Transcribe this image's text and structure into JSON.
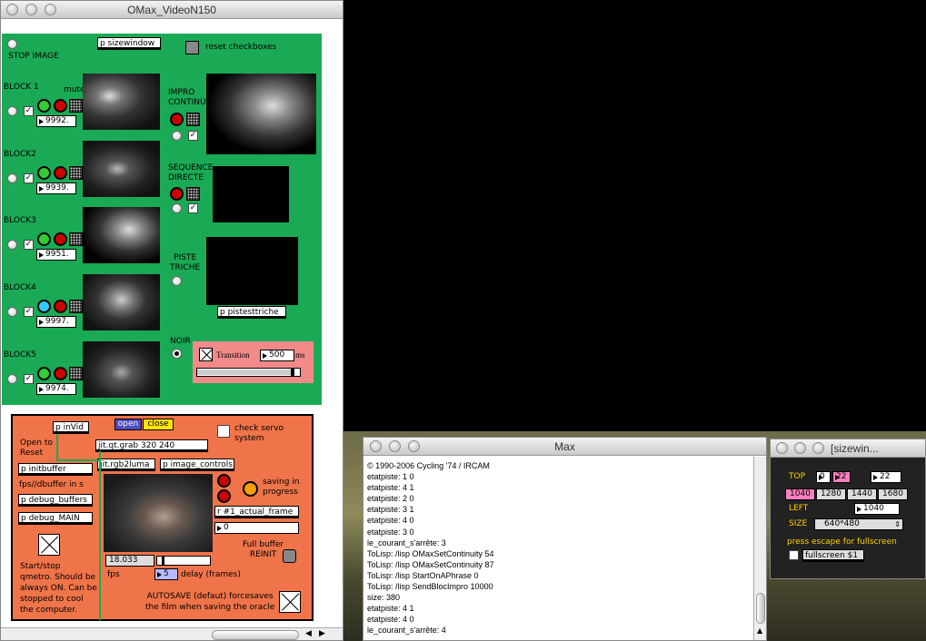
{
  "main_window": {
    "title": "OMax_VideoN150"
  },
  "patch": {
    "stop_image": "STOP IMAGE",
    "sizewindow": "p sizewindow",
    "reset_checkboxes": "reset checkboxes",
    "mute": "mute",
    "blocks": [
      {
        "label": "BLOCK 1",
        "value": "9992."
      },
      {
        "label": "BLOCK2",
        "value": "9939."
      },
      {
        "label": "BLOCK3",
        "value": "9951."
      },
      {
        "label": "BLOCK4",
        "value": "9997."
      },
      {
        "label": "BLOCK5",
        "value": "9974."
      }
    ],
    "impro_continue": "IMPRO\nCONTINUE",
    "sequence_directe": "SEQUENCE\nDIRECTE",
    "piste_triche": "PISTE\nTRICHE",
    "pistesttriche": "p pistesttriche",
    "noir": "NOIR",
    "transition": "Transition",
    "transition_value": "500",
    "transition_unit": "ms",
    "slider_level": 0.95
  },
  "control": {
    "pinvid": "p inVid",
    "open": "open",
    "close": "close",
    "check_servo": "check servo\nsystem",
    "open_to_reset": "Open to\nReset",
    "grab": "jit.qt.grab 320 240",
    "rgb2luma": "jit.rgb2luma",
    "image_controls": "p image_controls",
    "saving": "saving in\nprogress",
    "initbuffer": "p initbuffer",
    "fps_dbuffer": "fps//dbuffer in s",
    "debug_buffers": "p debug_buffers",
    "debug_main": "p debug_MAIN",
    "actual_frame": "r #1_actual_frame",
    "actual_frame_value": "0",
    "full_buffer": "Full buffer\nREINIT",
    "startstop": "Start/stop\nqmetro. Should be\nalways ON. Can be\nstopped to cool\nthe computer.",
    "fps_value": "18.033",
    "fps_label": "fps",
    "delay_value": "5",
    "delay_label": "delay (frames)",
    "autosave": "AUTOSAVE (defaut) forcesaves\nthe film when saving the oracle"
  },
  "console": {
    "title": "Max",
    "lines": [
      "© 1990-2006 Cycling '74 / IRCAM",
      "etatpiste: 1 0",
      "etatpiste: 4 1",
      "etatpiste: 2 0",
      "etatpiste: 3 1",
      "etatpiste: 4 0",
      "etatpiste: 3 0",
      "le_courant_s'arrête: 3",
      "ToLisp: /lisp OMaxSetContinuity 54",
      "ToLisp: /lisp OMaxSetContinuity 87",
      "ToLisp: /lisp StartOnAPhrase 0",
      "ToLisp: /lisp SendBlocImpro 10000",
      "size: 380",
      "etatpiste: 4 1",
      "etatpiste: 4 0",
      "le_courant_s'arrête: 4"
    ]
  },
  "sizewin": {
    "title": "[sizewin...",
    "top": "TOP",
    "top_a": "0",
    "top_b": "22",
    "top_c": "22",
    "widths": [
      "1040",
      "1280",
      "1440",
      "1680"
    ],
    "left": "LEFT",
    "left_value": "1040",
    "size": "SIZE",
    "size_value": "640*480",
    "press_escape": "press escape for fullscreen",
    "fullscreen": "fullscreen $1"
  },
  "colors": {
    "patch_green": "#1aaa55",
    "patch_orange": "#ef7449",
    "pink": "#ff7fbf",
    "transition_bg": "#f28a8a"
  }
}
